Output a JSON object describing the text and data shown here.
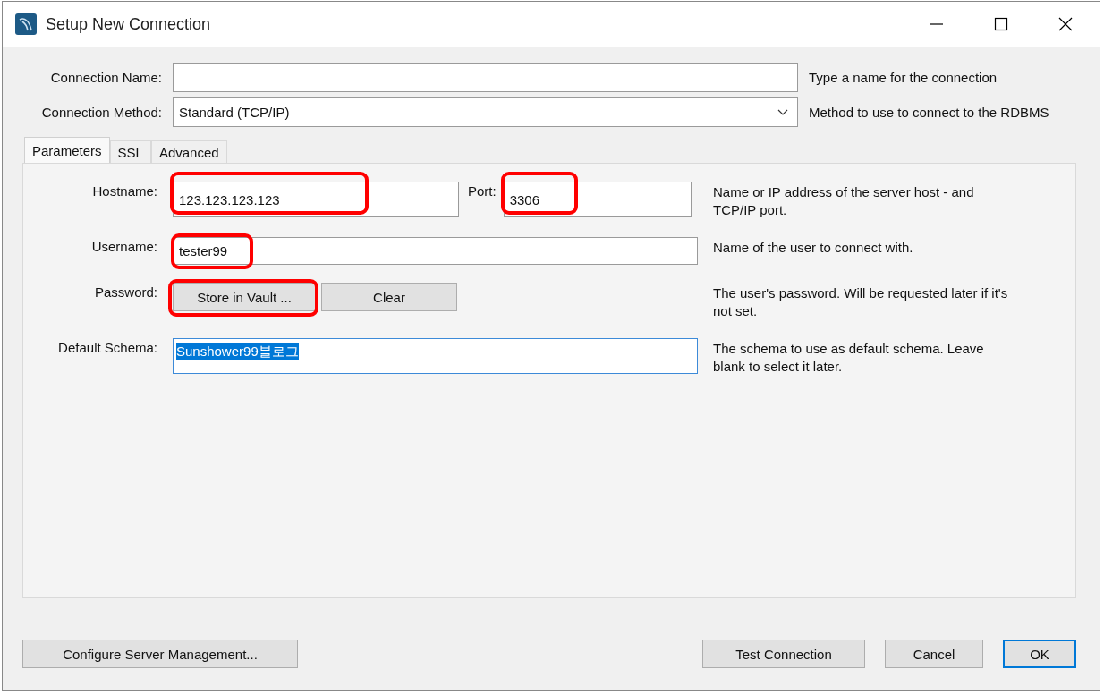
{
  "window": {
    "title": "Setup New Connection"
  },
  "connection_name": {
    "label": "Connection Name:",
    "hint": "Type a name for the connection"
  },
  "connection_method": {
    "label": "Connection Method:",
    "value": "Standard (TCP/IP)",
    "hint": "Method to use to connect to the RDBMS"
  },
  "tabs": [
    {
      "label": "Parameters",
      "selected": true
    },
    {
      "label": "SSL",
      "selected": false
    },
    {
      "label": "Advanced",
      "selected": false
    }
  ],
  "hostname": {
    "label": "Hostname:",
    "value": "123.123.123.123",
    "highlighted": true
  },
  "port": {
    "label": "Port:",
    "value": "3306",
    "highlighted": true,
    "hint": "Name or IP address of the server host - and TCP/IP port."
  },
  "username": {
    "label": "Username:",
    "value": "tester99",
    "highlighted": true,
    "hint": "Name of the user to connect with."
  },
  "password": {
    "label": "Password:",
    "hint": "The user's password. Will be requested later if it's not set.",
    "buttons": [
      {
        "label": "Store in Vault ...",
        "highlighted": true
      },
      {
        "label": "Clear",
        "highlighted": false
      }
    ]
  },
  "default_schema": {
    "label": "Default Schema:",
    "value": "Sunshower99블로그",
    "text_selected": true,
    "hint": "The schema to use as default schema. Leave blank to select it later."
  },
  "buttons": [
    {
      "label": "Configure Server Management...",
      "default": false
    },
    {
      "label": "Test Connection",
      "default": false
    },
    {
      "label": "Cancel",
      "default": false
    },
    {
      "label": "OK",
      "default": true
    }
  ]
}
